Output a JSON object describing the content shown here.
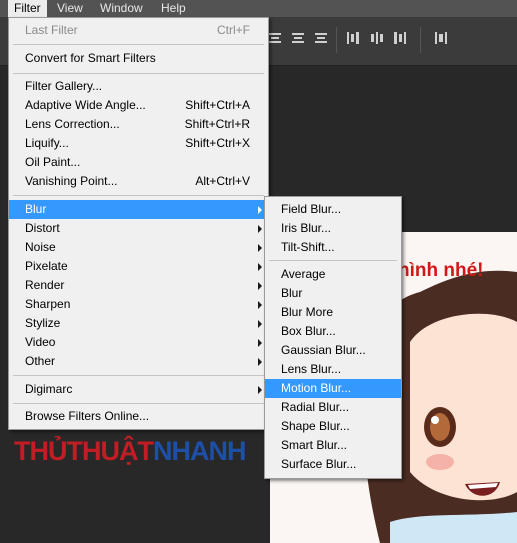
{
  "menubar": {
    "items": [
      "Filter",
      "View",
      "Window",
      "Help"
    ]
  },
  "filter_menu": {
    "last_filter": {
      "label": "Last Filter",
      "shortcut": "Ctrl+F"
    },
    "convert": "Convert for Smart Filters",
    "group1": [
      {
        "label": "Filter Gallery...",
        "shortcut": ""
      },
      {
        "label": "Adaptive Wide Angle...",
        "shortcut": "Shift+Ctrl+A"
      },
      {
        "label": "Lens Correction...",
        "shortcut": "Shift+Ctrl+R"
      },
      {
        "label": "Liquify...",
        "shortcut": "Shift+Ctrl+X"
      },
      {
        "label": "Oil Paint...",
        "shortcut": ""
      },
      {
        "label": "Vanishing Point...",
        "shortcut": "Alt+Ctrl+V"
      }
    ],
    "submenus": [
      "Blur",
      "Distort",
      "Noise",
      "Pixelate",
      "Render",
      "Sharpen",
      "Stylize",
      "Video",
      "Other"
    ],
    "digimarc": "Digimarc",
    "browse": "Browse Filters Online..."
  },
  "blur_menu": {
    "top": [
      "Field Blur...",
      "Iris Blur...",
      "Tilt-Shift..."
    ],
    "bottom": [
      "Average",
      "Blur",
      "Blur More",
      "Box Blur...",
      "Gaussian Blur...",
      "Lens Blur...",
      "Motion Blur...",
      "Radial Blur...",
      "Shape Blur...",
      "Smart Blur...",
      "Surface Blur..."
    ]
  },
  "canvas_text": "hình nhé!",
  "watermark": {
    "part1": "THỦTHUẬT",
    "part2": "NHANH"
  },
  "colors": {
    "highlight": "#3399ff",
    "menu_bg": "#f0f0f0",
    "menubar_bg": "#535353",
    "watermark_red": "#c21d24",
    "watermark_blue": "#1e4fa8"
  }
}
